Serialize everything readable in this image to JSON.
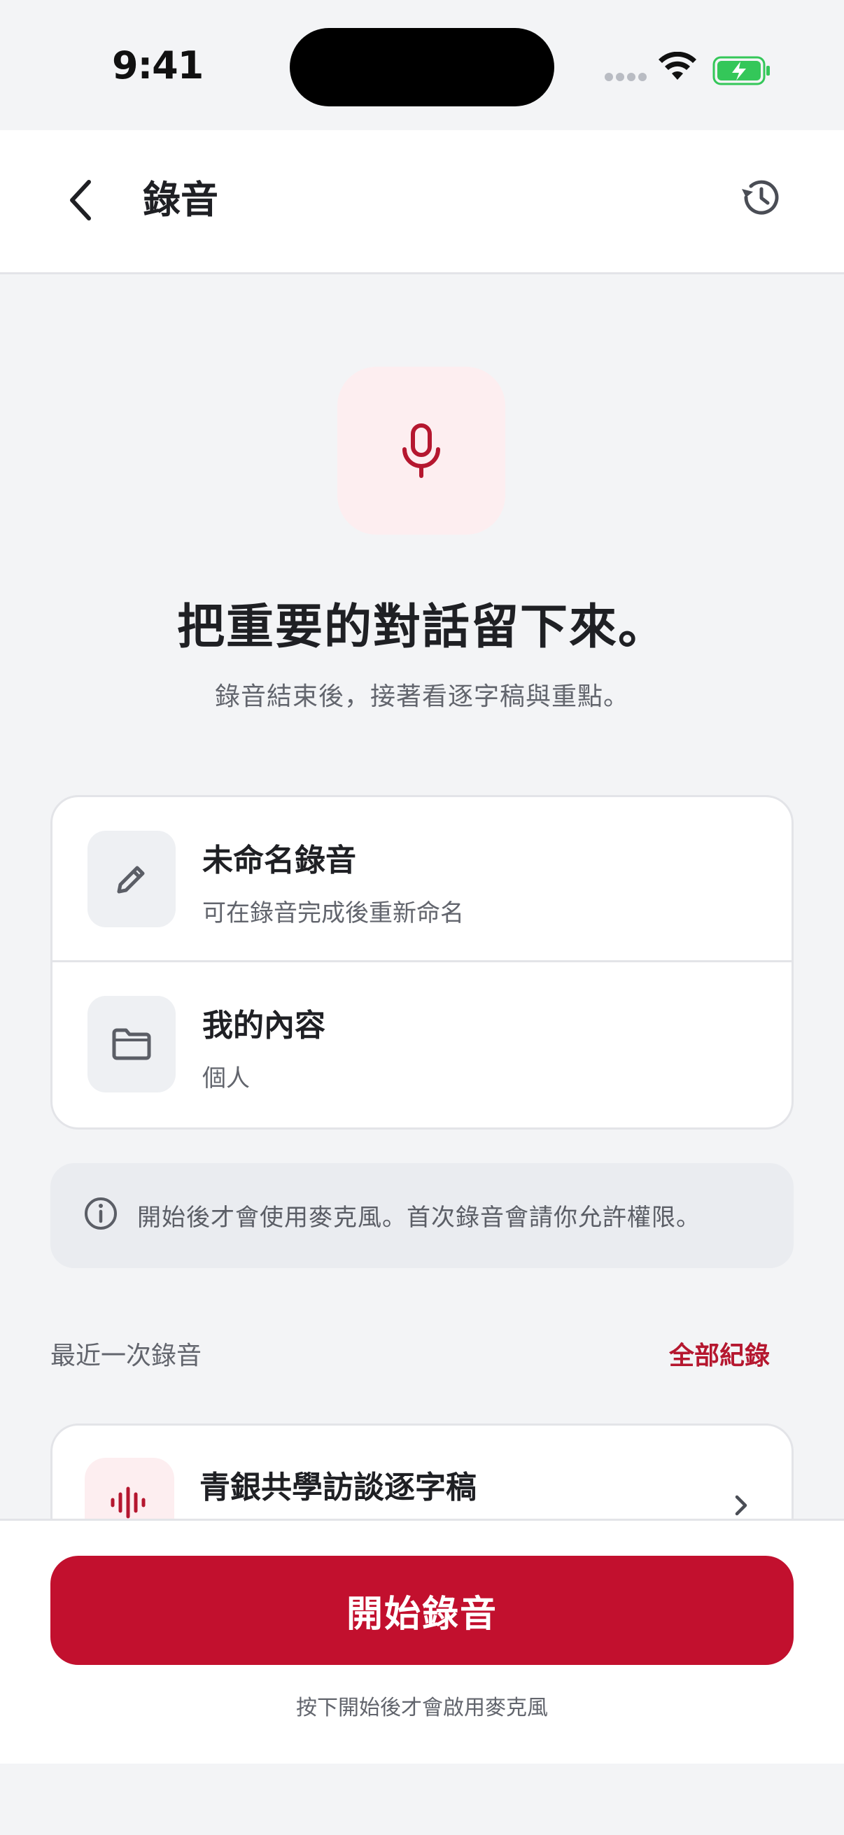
{
  "status_bar": {
    "time": "9:41"
  },
  "header": {
    "title": "錄音"
  },
  "hero": {
    "headline": "把重要的對話留下來。",
    "subline": "錄音結束後，接著看逐字稿與重點。"
  },
  "settings": [
    {
      "title": "未命名錄音",
      "subtitle": "可在錄音完成後重新命名",
      "icon": "pencil-icon"
    },
    {
      "title": "我的內容",
      "subtitle": "個人",
      "icon": "folder-icon"
    }
  ],
  "info": {
    "text": "開始後才會使用麥克風。首次錄音會請你允許權限。"
  },
  "recent": {
    "label": "最近一次錄音",
    "all_link": "全部紀錄",
    "item_title": "青銀共學訪談逐字稿"
  },
  "bottom": {
    "primary_label": "開始錄音",
    "note": "按下開始後才會啟用麥克風"
  },
  "colors": {
    "accent": "#c2102e",
    "accent_soft": "#fdeef0",
    "background": "#f3f4f6"
  }
}
